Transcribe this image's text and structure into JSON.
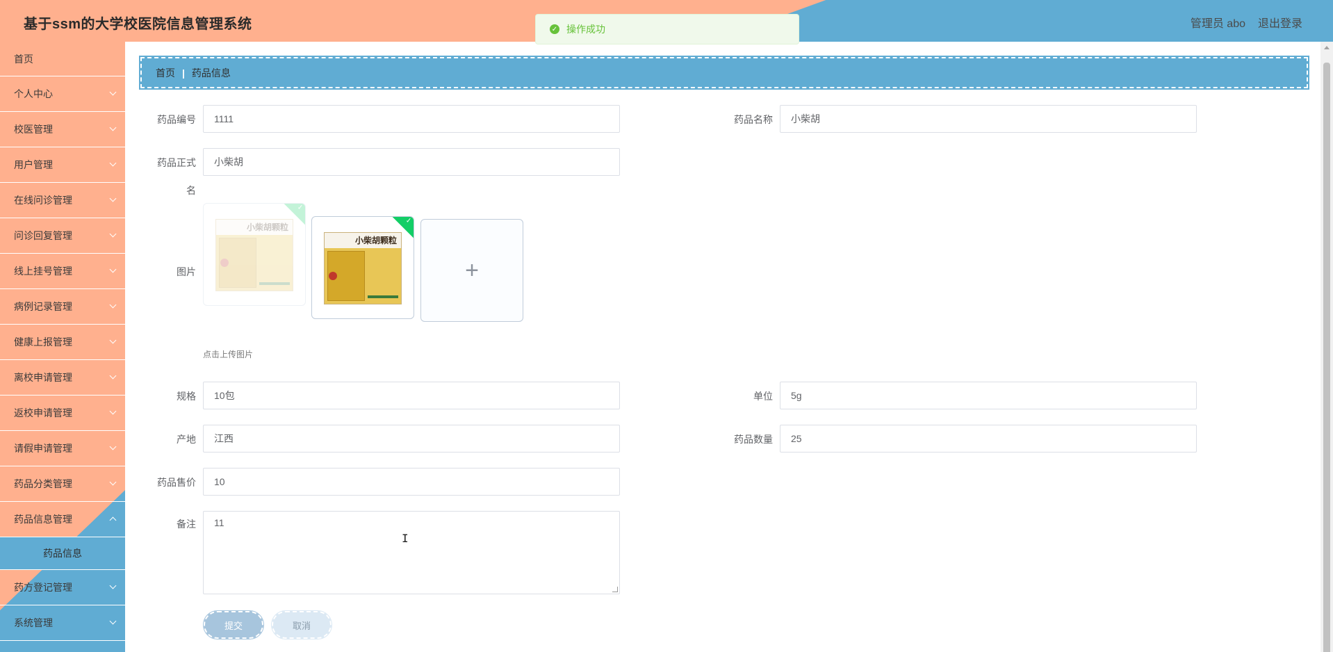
{
  "header": {
    "title": "基于ssm的大学校医院信息管理系统",
    "user": "管理员 abo",
    "logout": "退出登录"
  },
  "toast": {
    "message": "操作成功",
    "icon": "check-circle-icon"
  },
  "sidebar": {
    "items": [
      {
        "label": "首页"
      },
      {
        "label": "个人中心"
      },
      {
        "label": "校医管理"
      },
      {
        "label": "用户管理"
      },
      {
        "label": "在线问诊管理"
      },
      {
        "label": "问诊回复管理"
      },
      {
        "label": "线上挂号管理"
      },
      {
        "label": "病例记录管理"
      },
      {
        "label": "健康上报管理"
      },
      {
        "label": "离校申请管理"
      },
      {
        "label": "返校申请管理"
      },
      {
        "label": "请假申请管理"
      },
      {
        "label": "药品分类管理"
      },
      {
        "label": "药品信息管理"
      },
      {
        "label": "药方登记管理"
      },
      {
        "label": "系统管理"
      }
    ],
    "subitem": "药品信息"
  },
  "breadcrumb": {
    "home": "首页",
    "current": "药品信息"
  },
  "form": {
    "code_label": "药品编号",
    "code_value": "1111",
    "name_label": "药品名称",
    "name_value": "小柴胡",
    "formal_label_1": "药品正式",
    "formal_label_2": "名",
    "formal_value": "小柴胡",
    "image_label": "图片",
    "image_box_text": "小柴胡颗粒",
    "upload_hint": "点击上传图片",
    "add_symbol": "+",
    "spec_label": "规格",
    "spec_value": "10包",
    "unit_label": "单位",
    "unit_value": "5g",
    "origin_label": "产地",
    "origin_value": "江西",
    "qty_label": "药品数量",
    "qty_value": "25",
    "price_label": "药品售价",
    "price_value": "10",
    "note_label": "备注",
    "note_value": "11",
    "submit": "提交",
    "cancel": "取消"
  },
  "colors": {
    "accent_orange": "#ffb08e",
    "accent_blue": "#60acd3",
    "success": "#67c23a"
  }
}
